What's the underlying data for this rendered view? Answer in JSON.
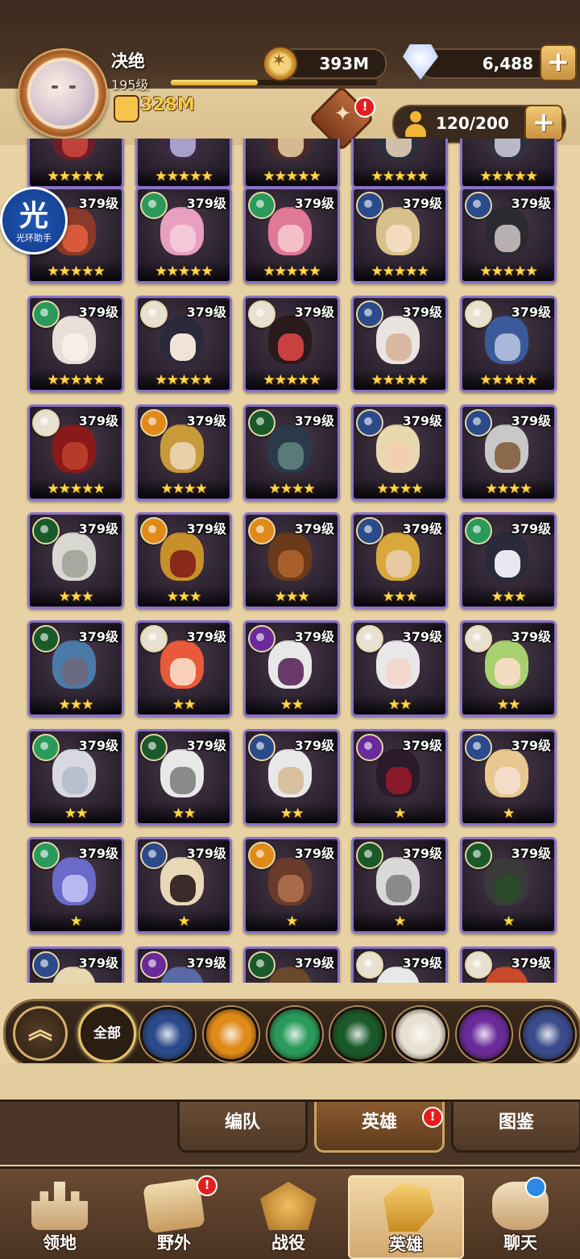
{
  "player": {
    "name": "决绝",
    "level": "195级",
    "exp_fraction": 0.42,
    "power": "328M"
  },
  "resources": {
    "gold": "393M",
    "gems": "6,488"
  },
  "roster": {
    "count": "120/200"
  },
  "notifications": {
    "emblem_badge": "!",
    "nav_wild_badge": "!",
    "heroes_tab_badge": "!"
  },
  "helper": {
    "glyph": "光",
    "label": "光环助手"
  },
  "heroes": [
    {
      "level": "",
      "stars": "★★★★★",
      "faction": "lightbearer",
      "palette": [
        "#6a1f2a",
        "#c0403a"
      ]
    },
    {
      "level": "",
      "stars": "★★★★★",
      "faction": "lightbearer",
      "palette": [
        "#3a2a44",
        "#a8a0c8"
      ]
    },
    {
      "level": "",
      "stars": "★★★★★",
      "faction": "lightbearer",
      "palette": [
        "#4a2a2a",
        "#d8b890"
      ]
    },
    {
      "level": "",
      "stars": "★★★★★",
      "faction": "lightbearer",
      "palette": [
        "#2a3040",
        "#d0c0a8"
      ]
    },
    {
      "level": "",
      "stars": "★★★★★",
      "faction": "lightbearer",
      "palette": [
        "#303040",
        "#b8b8c8"
      ]
    },
    {
      "level": "379级",
      "stars": "★★★★★",
      "faction": "wilder",
      "palette": [
        "#8a3a2a",
        "#d85a3a"
      ]
    },
    {
      "level": "379级",
      "stars": "★★★★★",
      "faction": "wilder",
      "palette": [
        "#e8a0c0",
        "#f4c8d8"
      ]
    },
    {
      "level": "379级",
      "stars": "★★★★★",
      "faction": "wilder",
      "palette": [
        "#e07898",
        "#f4c0c8"
      ]
    },
    {
      "level": "379级",
      "stars": "★★★★★",
      "faction": "lightbearer",
      "palette": [
        "#d8c08a",
        "#f4dcc0"
      ]
    },
    {
      "level": "379级",
      "stars": "★★★★★",
      "faction": "lightbearer",
      "palette": [
        "#2a2a30",
        "#b8b0b0"
      ]
    },
    {
      "level": "379级",
      "stars": "★★★★★",
      "faction": "wilder",
      "palette": [
        "#e8e0d8",
        "#f8eee8"
      ]
    },
    {
      "level": "379级",
      "stars": "★★★★★",
      "faction": "celestial",
      "palette": [
        "#2a2a3a",
        "#f0e4d8"
      ]
    },
    {
      "level": "379级",
      "stars": "★★★★★",
      "faction": "celestial",
      "palette": [
        "#2a1a1a",
        "#c84040"
      ]
    },
    {
      "level": "379级",
      "stars": "★★★★★",
      "faction": "lightbearer",
      "palette": [
        "#e8e4e0",
        "#d8b8a0"
      ]
    },
    {
      "level": "379级",
      "stars": "★★★★★",
      "faction": "celestial",
      "palette": [
        "#3a5a9a",
        "#a8b8d8"
      ]
    },
    {
      "level": "379级",
      "stars": "★★★★★",
      "faction": "celestial",
      "palette": [
        "#8a1a1a",
        "#b83a2a"
      ]
    },
    {
      "level": "379级",
      "stars": "★★★★",
      "faction": "maulers",
      "palette": [
        "#c89a3a",
        "#e8d0a8"
      ]
    },
    {
      "level": "379级",
      "stars": "★★★★",
      "faction": "graveborn",
      "palette": [
        "#2a3a4a",
        "#5a7a7a"
      ]
    },
    {
      "level": "379级",
      "stars": "★★★★",
      "faction": "lightbearer",
      "palette": [
        "#e8d8b0",
        "#f0d0b0"
      ]
    },
    {
      "level": "379级",
      "stars": "★★★★",
      "faction": "lightbearer",
      "palette": [
        "#c8c8c8",
        "#8a6a4a"
      ]
    },
    {
      "level": "379级",
      "stars": "★★★",
      "faction": "graveborn",
      "palette": [
        "#d8d8d0",
        "#a8a8a0"
      ]
    },
    {
      "level": "379级",
      "stars": "★★★",
      "faction": "maulers",
      "palette": [
        "#c8902a",
        "#8a2a1a"
      ]
    },
    {
      "level": "379级",
      "stars": "★★★",
      "faction": "maulers",
      "palette": [
        "#6a3a1a",
        "#a8602a"
      ]
    },
    {
      "level": "379级",
      "stars": "★★★",
      "faction": "lightbearer",
      "palette": [
        "#d8a83a",
        "#e8c8a0"
      ]
    },
    {
      "level": "379级",
      "stars": "★★★",
      "faction": "wilder",
      "palette": [
        "#2a2a3a",
        "#e8e8f0"
      ]
    },
    {
      "level": "379级",
      "stars": "★★★",
      "faction": "graveborn",
      "palette": [
        "#4a7aa8",
        "#6a6a80"
      ]
    },
    {
      "level": "379级",
      "stars": "★★",
      "faction": "celestial",
      "palette": [
        "#e85a3a",
        "#f8d0b8"
      ]
    },
    {
      "level": "379级",
      "stars": "★★",
      "faction": "hypogean",
      "palette": [
        "#e8e8e8",
        "#6a3a6a"
      ]
    },
    {
      "level": "379级",
      "stars": "★★",
      "faction": "celestial",
      "palette": [
        "#e8e8e8",
        "#f4d8d0"
      ]
    },
    {
      "level": "379级",
      "stars": "★★",
      "faction": "celestial",
      "palette": [
        "#a8d070",
        "#f4dcc0"
      ]
    },
    {
      "level": "379级",
      "stars": "★★",
      "faction": "wilder",
      "palette": [
        "#d8d8e0",
        "#b8c0d0"
      ]
    },
    {
      "level": "379级",
      "stars": "★★",
      "faction": "graveborn",
      "palette": [
        "#e8e8e8",
        "#8a8a8a"
      ]
    },
    {
      "level": "379级",
      "stars": "★★",
      "faction": "lightbearer",
      "palette": [
        "#e8e8e8",
        "#d8c0a0"
      ]
    },
    {
      "level": "379级",
      "stars": "★",
      "faction": "hypogean",
      "palette": [
        "#2a1a2a",
        "#8a1a2a"
      ]
    },
    {
      "level": "379级",
      "stars": "★",
      "faction": "lightbearer",
      "palette": [
        "#e8c890",
        "#f4dcc8"
      ]
    },
    {
      "level": "379级",
      "stars": "★",
      "faction": "wilder",
      "palette": [
        "#6a6ac8",
        "#b8b8f0"
      ]
    },
    {
      "level": "379级",
      "stars": "★",
      "faction": "lightbearer",
      "palette": [
        "#e8d8b8",
        "#3a2a2a"
      ]
    },
    {
      "level": "379级",
      "stars": "★",
      "faction": "maulers",
      "palette": [
        "#6a3a2a",
        "#a86a4a"
      ]
    },
    {
      "level": "379级",
      "stars": "★",
      "faction": "graveborn",
      "palette": [
        "#d8d8d8",
        "#8a8a8a"
      ]
    },
    {
      "level": "379级",
      "stars": "★",
      "faction": "graveborn",
      "palette": [
        "#3a3a3a",
        "#2a4a2a"
      ]
    },
    {
      "level": "379级",
      "stars": "",
      "faction": "lightbearer",
      "palette": [
        "#e8d8b0",
        "#f0d0b0"
      ]
    },
    {
      "level": "379级",
      "stars": "",
      "faction": "hypogean",
      "palette": [
        "#5a6aa8",
        "#a8b8e8"
      ]
    },
    {
      "level": "379级",
      "stars": "",
      "faction": "graveborn",
      "palette": [
        "#6a4a2a",
        "#a8804a"
      ]
    },
    {
      "level": "379级",
      "stars": "",
      "faction": "celestial",
      "palette": [
        "#e8e8e8",
        "#c8c8c8"
      ]
    },
    {
      "level": "379级",
      "stars": "",
      "faction": "celestial",
      "palette": [
        "#c84a2a",
        "#e8904a"
      ]
    }
  ],
  "faction_colors": {
    "lightbearer": "#2a4a8a",
    "maulers": "#e08a1a",
    "wilder": "#2a9a5a",
    "graveborn": "#1a5a2a",
    "celestial": "#e8e0d0",
    "hypogean": "#6a2a9a",
    "dimensional": "#3a4a8a"
  },
  "filter_bar": {
    "all_label": "全部",
    "collapse_glyph": "︽",
    "factions": [
      "lightbearer",
      "maulers",
      "wilder",
      "graveborn",
      "celestial",
      "hypogean",
      "dimensional"
    ]
  },
  "subtabs": {
    "formation": "编队",
    "heroes": "英雄",
    "codex": "图鉴"
  },
  "bottom_nav": {
    "territory": "领地",
    "wild": "野外",
    "campaign": "战役",
    "heroes": "英雄",
    "chat": "聊天"
  }
}
